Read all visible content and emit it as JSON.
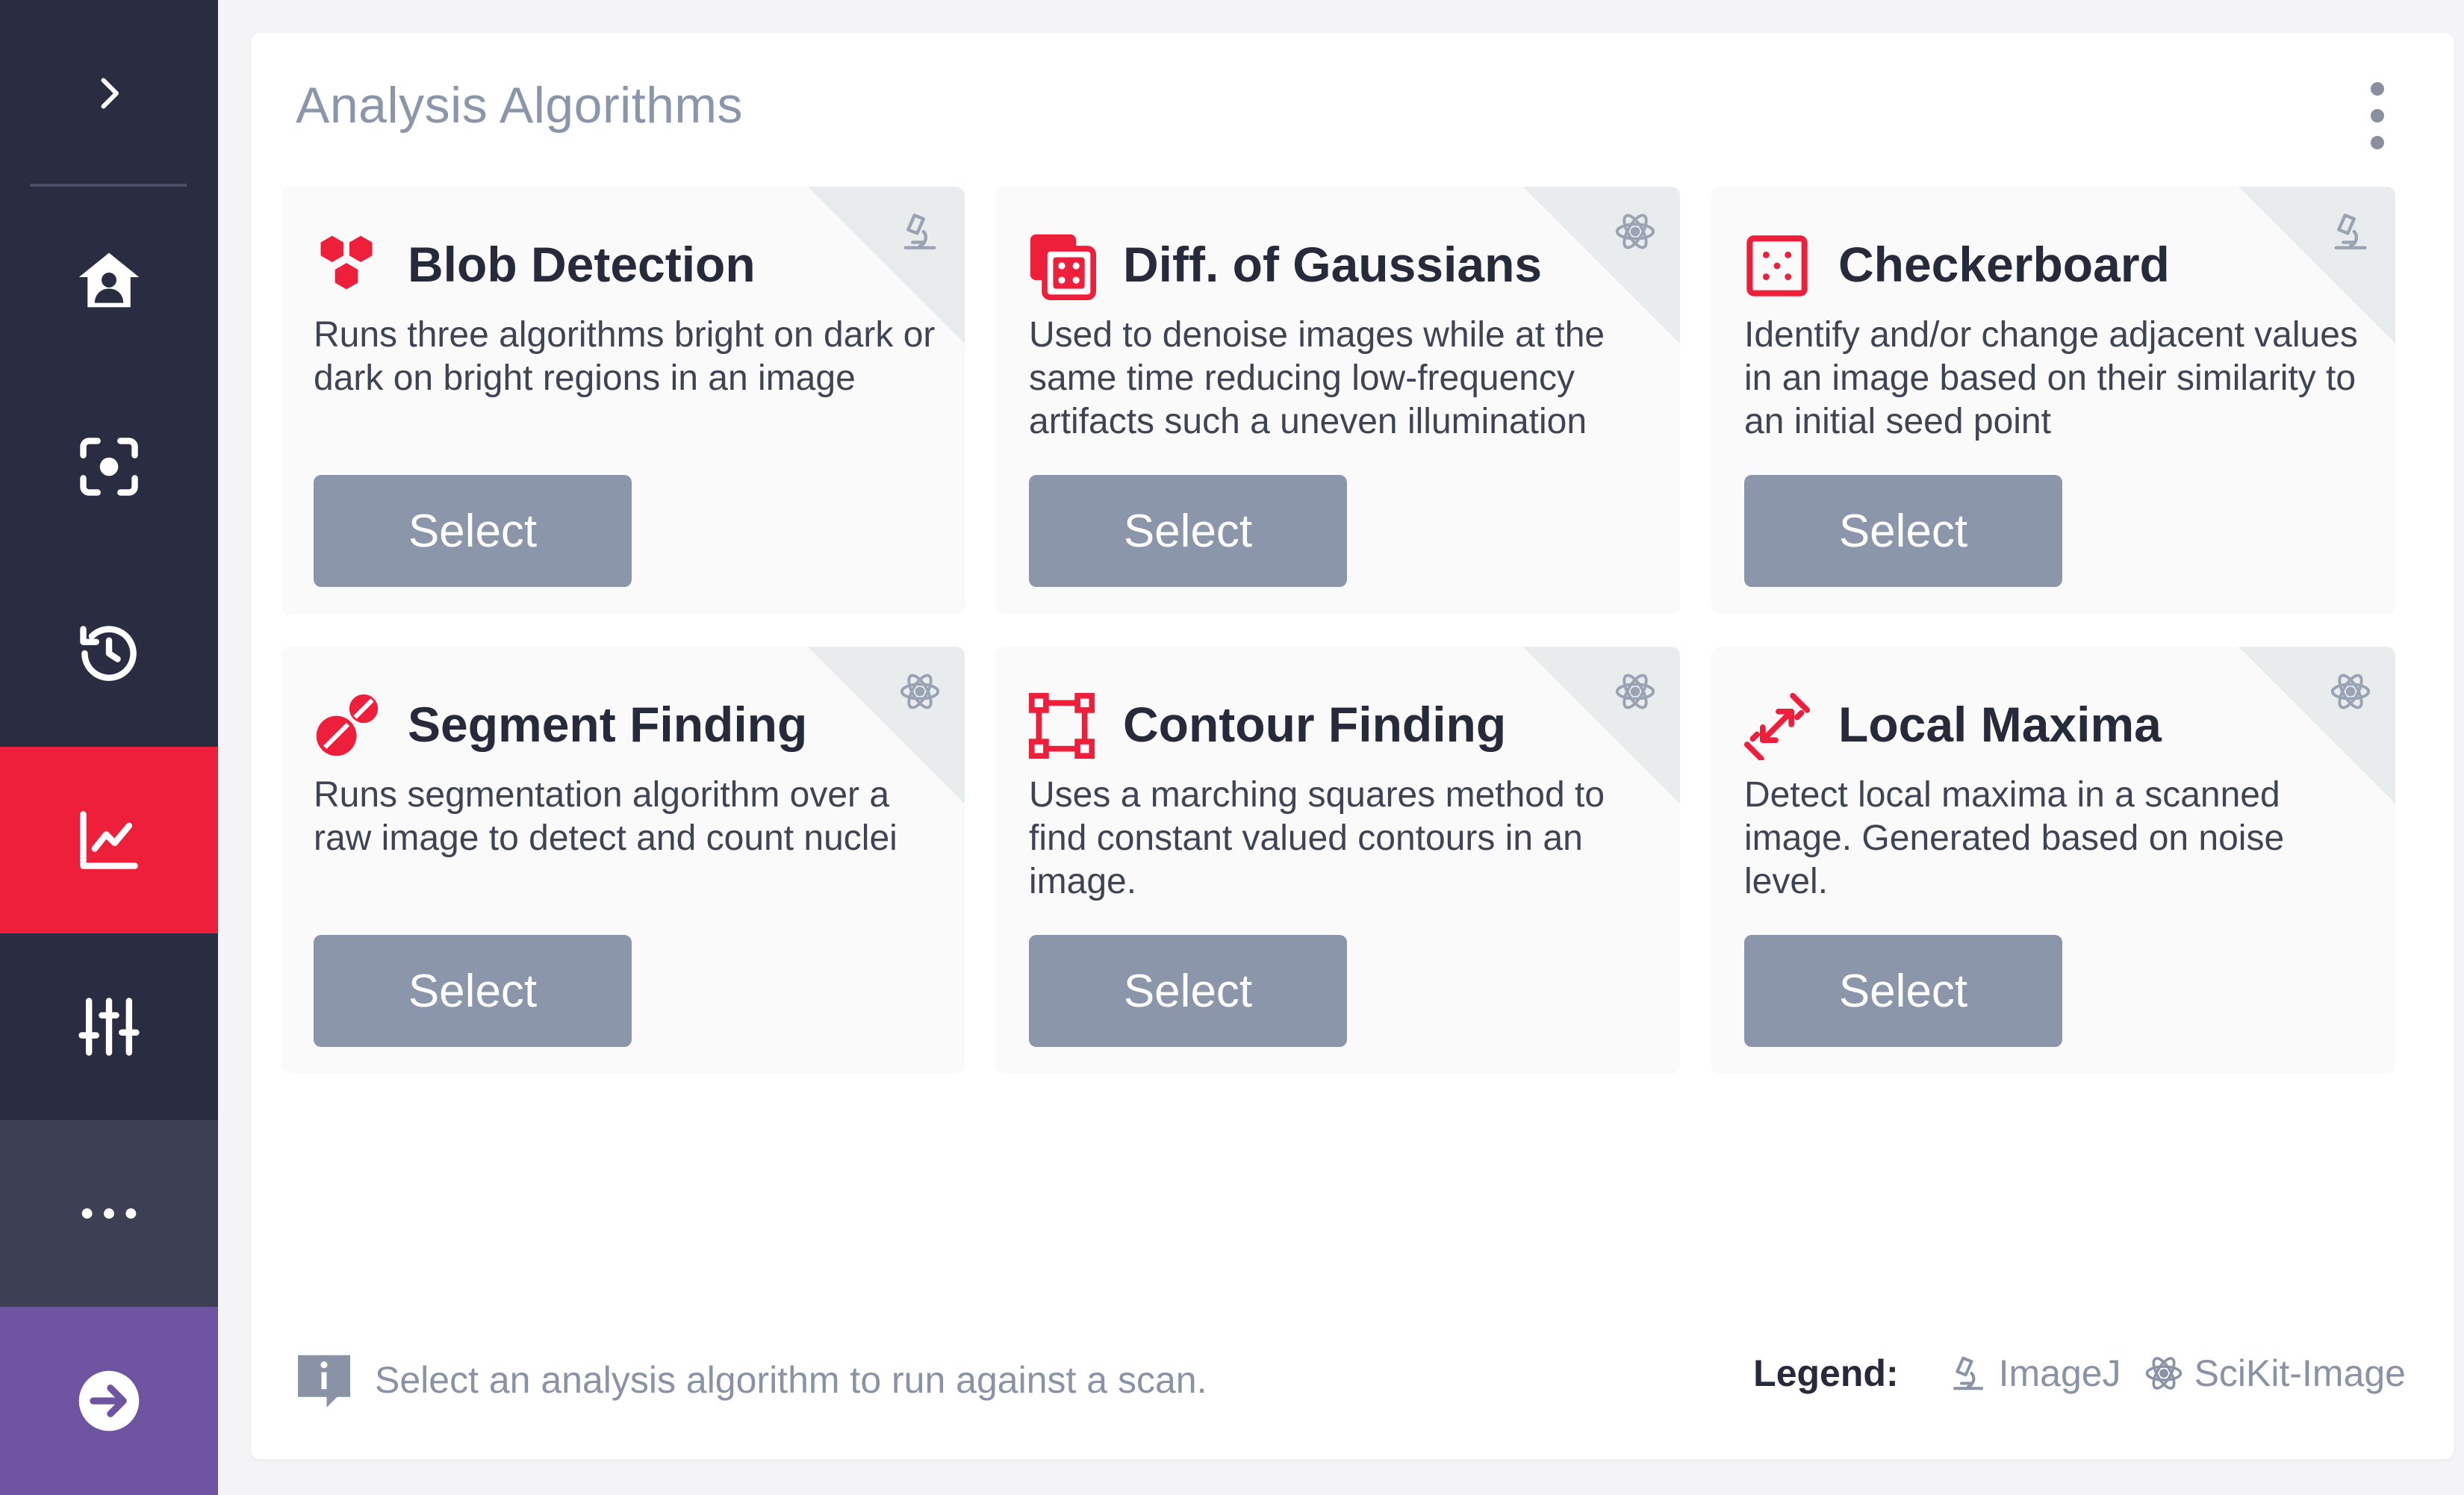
{
  "sidebar": {
    "items": [
      {
        "name": "expand",
        "icon": "chevron-right-icon"
      },
      {
        "name": "home",
        "icon": "home-user-icon"
      },
      {
        "name": "scan",
        "icon": "focus-scan-icon"
      },
      {
        "name": "history",
        "icon": "history-icon"
      },
      {
        "name": "analysis",
        "icon": "line-chart-icon",
        "active": true
      },
      {
        "name": "settings",
        "icon": "sliders-icon"
      },
      {
        "name": "more",
        "icon": "more-horizontal-icon"
      },
      {
        "name": "logout",
        "icon": "arrow-right-circle-icon"
      }
    ],
    "colors": {
      "background": "#2a2d42",
      "active": "#ee1f3b",
      "more": "#3d3f54",
      "logout": "#6e54a1"
    }
  },
  "panel": {
    "title": "Analysis Algorithms",
    "menu_icon": "kebab-menu-icon"
  },
  "cards": [
    {
      "title": "Blob Detection",
      "description": "Runs three algorithms bright on dark or dark on bright regions in an image",
      "button": "Select",
      "icon": "hexagon-cluster-icon",
      "source": "ImageJ",
      "source_icon": "microscope-icon"
    },
    {
      "title": "Diff. of Gaussians",
      "description": "Used to denoise images while at the same time reducing low-frequency artifacts such a uneven illumination",
      "button": "Select",
      "icon": "layered-squares-icon",
      "source": "SciKit-Image",
      "source_icon": "atom-icon"
    },
    {
      "title": "Checkerboard",
      "description": "Identify and/or change adjacent values in an image based on their similarity to an initial seed point",
      "button": "Select",
      "icon": "dotted-grid-icon",
      "source": "ImageJ",
      "source_icon": "microscope-icon"
    },
    {
      "title": "Segment Finding",
      "description": "Runs segmentation algorithm over a raw image to detect and count nuclei",
      "button": "Select",
      "icon": "split-circles-icon",
      "source": "SciKit-Image",
      "source_icon": "atom-icon"
    },
    {
      "title": "Contour Finding",
      "description": "Uses a marching squares method to find constant valued contours in an image.",
      "button": "Select",
      "icon": "vector-square-icon",
      "source": "SciKit-Image",
      "source_icon": "atom-icon"
    },
    {
      "title": "Local Maxima",
      "description": "Detect local maxima in a scanned image. Generated based on noise level.",
      "button": "Select",
      "icon": "diagonal-arrows-icon",
      "source": "SciKit-Image",
      "source_icon": "atom-icon"
    }
  ],
  "footer": {
    "info_text": "Select an analysis algorithm to run against a scan.",
    "info_icon": "info-bubble-icon",
    "legend_label": "Legend:",
    "legend_items": [
      {
        "label": "ImageJ",
        "icon": "microscope-icon"
      },
      {
        "label": "SciKit-Image",
        "icon": "atom-icon"
      }
    ]
  },
  "colors": {
    "accent": "#ee1f3b",
    "button": "#8b96aa",
    "muted_text": "#8a93a6"
  }
}
